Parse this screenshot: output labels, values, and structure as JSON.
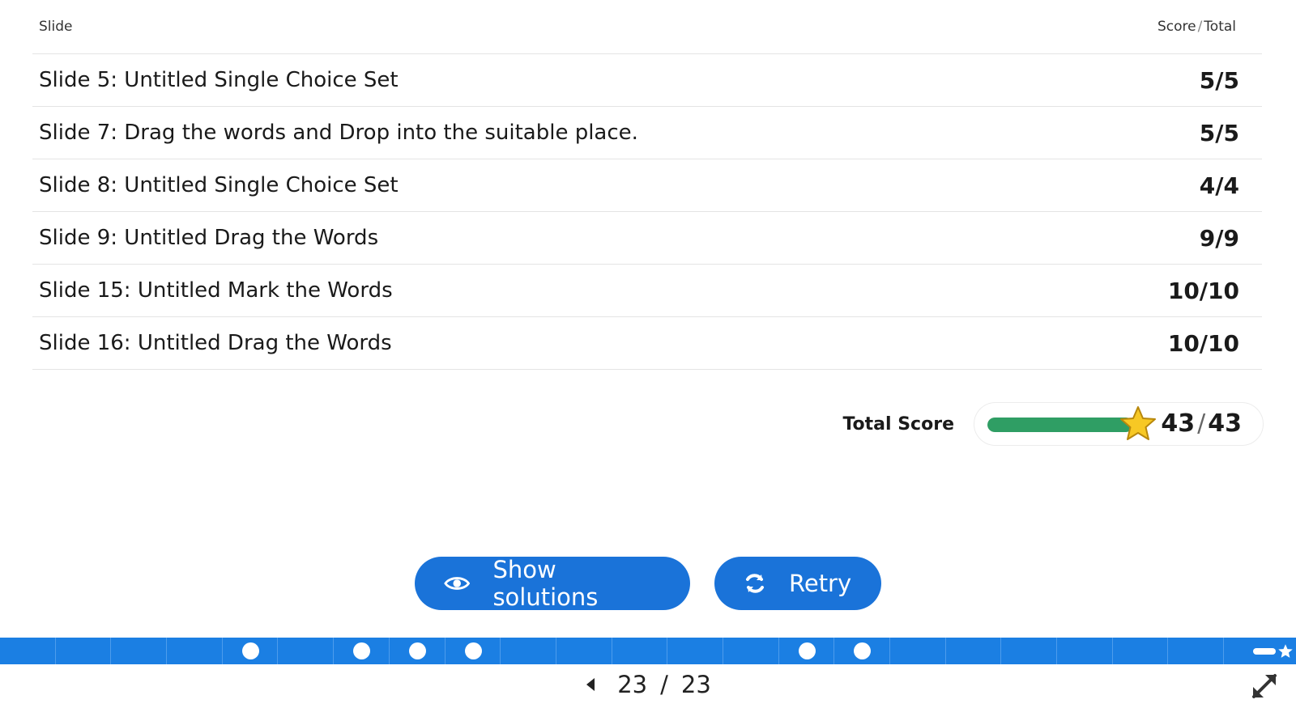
{
  "table": {
    "header_slide": "Slide",
    "header_score": "Score",
    "header_total": "Total",
    "header_sep": "/",
    "rows": [
      {
        "title": "Slide 5: Untitled Single Choice Set",
        "score": "5/5"
      },
      {
        "title": "Slide 7: Drag the words and Drop into the suitable place.",
        "score": "5/5"
      },
      {
        "title": "Slide 8: Untitled Single Choice Set",
        "score": "4/4"
      },
      {
        "title": "Slide 9: Untitled Drag the Words",
        "score": "9/9"
      },
      {
        "title": "Slide 15: Untitled Mark the Words",
        "score": "10/10"
      },
      {
        "title": "Slide 16: Untitled Drag the Words",
        "score": "10/10"
      }
    ]
  },
  "total": {
    "label": "Total Score",
    "score": "43",
    "max": "43",
    "sep": "/",
    "progress": 1.0
  },
  "buttons": {
    "show_solutions": "Show solutions",
    "retry": "Retry"
  },
  "progress_bar": {
    "segments": 23,
    "answered_slides": [
      5,
      7,
      8,
      9,
      15,
      16
    ],
    "current": 23
  },
  "nav": {
    "current": "23",
    "sep": "/",
    "total": "23"
  },
  "colors": {
    "accent": "#1a73d9",
    "progress": "#1b7fe3",
    "score_bar": "#2f9e64",
    "star": "#f7c824"
  },
  "icons": {
    "show_solutions": "eye-icon",
    "retry": "refresh-icon",
    "prev": "caret-left-icon",
    "fullscreen": "expand-icon",
    "total": "star-icon"
  }
}
